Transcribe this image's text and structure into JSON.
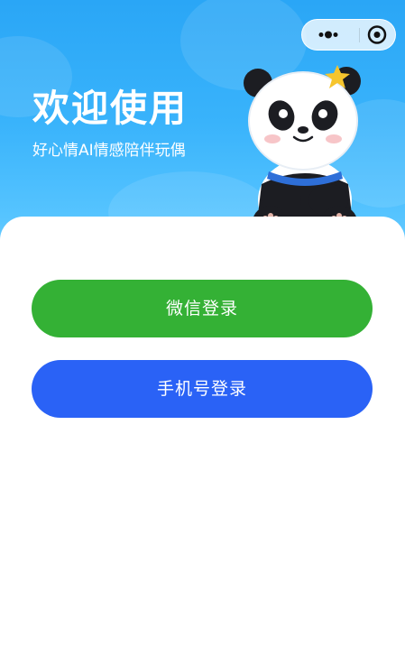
{
  "hero": {
    "title": "欢迎使用",
    "subtitle": "好心情AI情感陪伴玩偶"
  },
  "capsule": {
    "more_icon": "more-dots-icon",
    "close_icon": "circle-target-icon"
  },
  "login": {
    "wechat_label": "微信登录",
    "phone_label": "手机号登录"
  },
  "colors": {
    "hero_gradient_top": "#2aa6f6",
    "hero_gradient_bottom": "#78d1ff",
    "wechat_green": "#34b135",
    "phone_blue": "#2a62f6"
  }
}
